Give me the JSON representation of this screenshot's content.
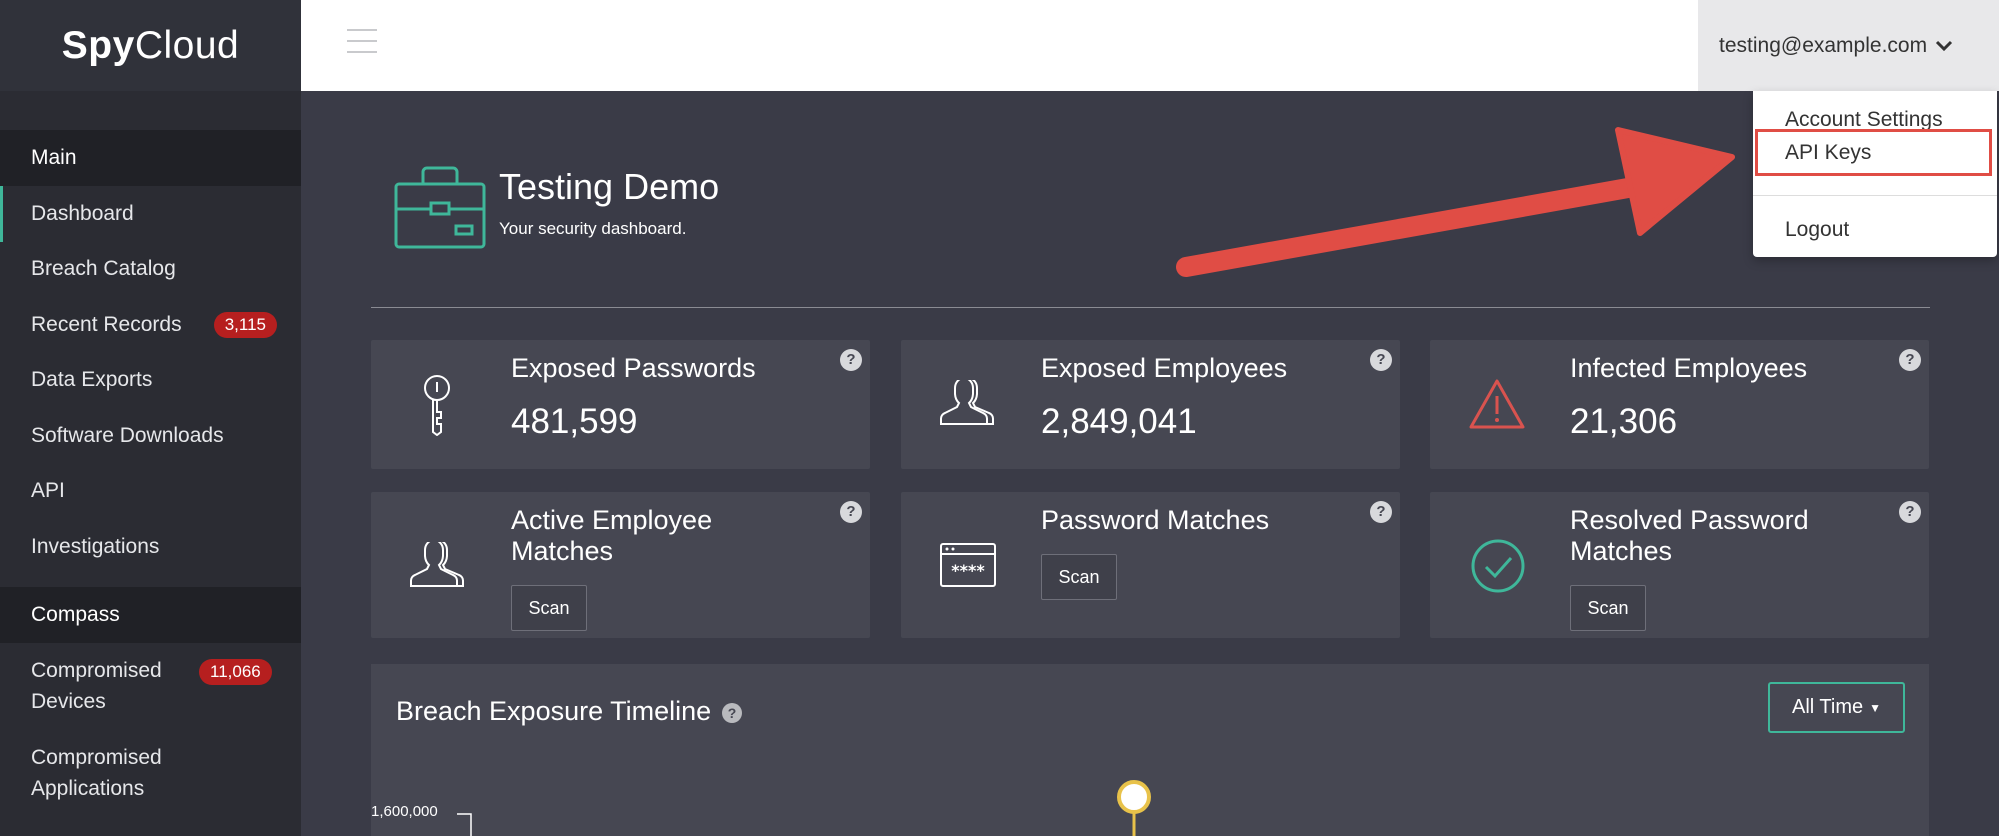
{
  "brand": {
    "name_bold": "Spy",
    "name_light": "Cloud"
  },
  "sidebar": {
    "sections": [
      {
        "label": "Main"
      },
      {
        "label": "Compass"
      }
    ],
    "main_items": [
      {
        "label": "Dashboard"
      },
      {
        "label": "Breach Catalog"
      },
      {
        "label": "Recent Records",
        "badge": "3,115"
      },
      {
        "label": "Data Exports"
      },
      {
        "label": "Software Downloads"
      },
      {
        "label": "API"
      },
      {
        "label": "Investigations"
      }
    ],
    "compass_items": [
      {
        "label": "Compromised Devices",
        "badge": "11,066"
      },
      {
        "label": "Compromised Applications"
      }
    ]
  },
  "topbar": {
    "user_email": "testing@example.com"
  },
  "user_dropdown": {
    "items": [
      {
        "label": "Account Settings"
      },
      {
        "label": "API Keys"
      },
      {
        "label": "Logout"
      }
    ]
  },
  "header": {
    "title": "Testing Demo",
    "subtitle": "Your security dashboard."
  },
  "cards": [
    {
      "title": "Exposed Passwords",
      "value": "481,599",
      "icon": "key-icon"
    },
    {
      "title": "Exposed Employees",
      "value": "2,849,041",
      "icon": "users-icon"
    },
    {
      "title": "Infected Employees",
      "value": "21,306",
      "icon": "warning-icon",
      "icon_color": "#d9534f"
    },
    {
      "title": "Active Employee Matches",
      "button": "Scan",
      "icon": "users-icon"
    },
    {
      "title": "Password Matches",
      "button": "Scan",
      "icon": "password-window-icon"
    },
    {
      "title": "Resolved Password Matches",
      "button": "Scan",
      "icon": "check-circle-icon",
      "icon_color": "#3fb79a"
    }
  ],
  "help_glyph": "?",
  "timeline": {
    "title": "Breach Exposure Timeline",
    "range_select": "All Time",
    "axis_tick": "1,600,000"
  },
  "colors": {
    "accent": "#3fb79a",
    "badge": "#b61f1f",
    "annotation": "#e04d45",
    "sidebar_bg": "#2b2c33",
    "content_bg": "#3a3b47",
    "card_bg": "#464752"
  }
}
